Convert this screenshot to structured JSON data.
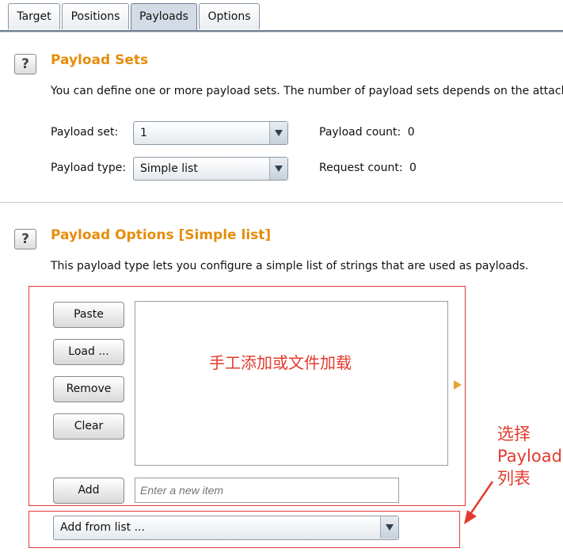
{
  "tabs": [
    "Target",
    "Positions",
    "Payloads",
    "Options"
  ],
  "active_tab": "Payloads",
  "payload_sets": {
    "help": "?",
    "title": "Payload Sets",
    "description": "You can define one or more payload sets. The number of payload sets depends on the attack",
    "payload_set_label": "Payload set:",
    "payload_set_value": "1",
    "payload_type_label": "Payload type:",
    "payload_type_value": "Simple list",
    "payload_count_label": "Payload count:",
    "payload_count_value": "0",
    "request_count_label": "Request count:",
    "request_count_value": "0"
  },
  "payload_options": {
    "help": "?",
    "title": "Payload Options [Simple list]",
    "description": "This payload type lets you configure a simple list of strings that are used as payloads.",
    "buttons": {
      "paste": "Paste",
      "load": "Load ...",
      "remove": "Remove",
      "clear": "Clear",
      "add": "Add"
    },
    "new_item_placeholder": "Enter a new item",
    "add_from_list": "Add from list ..."
  },
  "annotations": {
    "list_note": "手工添加或文件加载",
    "side_line1": "选择",
    "side_line2": "Payload",
    "side_line3": "列表"
  },
  "colors": {
    "section_title": "#e58d0c",
    "annotation": "#e23b2e"
  }
}
